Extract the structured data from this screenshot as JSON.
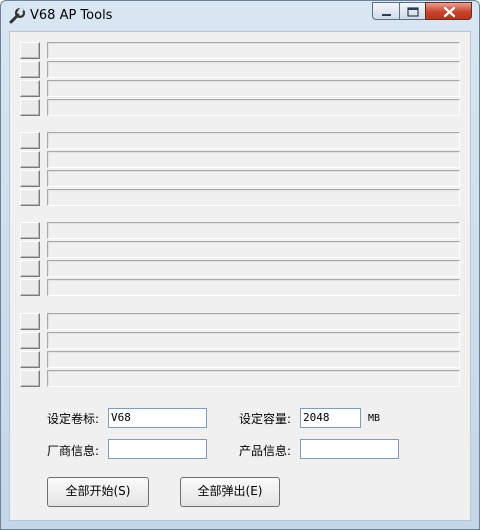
{
  "window": {
    "title": "V68 AP Tools",
    "app_icon": "wrench-icon",
    "controls": [
      "minimize-icon",
      "maximize-icon",
      "close-icon"
    ]
  },
  "port_groups": [
    {
      "rows": [
        {
          "status": ""
        },
        {
          "status": ""
        },
        {
          "status": ""
        },
        {
          "status": ""
        }
      ]
    },
    {
      "rows": [
        {
          "status": ""
        },
        {
          "status": ""
        },
        {
          "status": ""
        },
        {
          "status": ""
        }
      ]
    },
    {
      "rows": [
        {
          "status": ""
        },
        {
          "status": ""
        },
        {
          "status": ""
        },
        {
          "status": ""
        }
      ]
    },
    {
      "rows": [
        {
          "status": ""
        },
        {
          "status": ""
        },
        {
          "status": ""
        },
        {
          "status": ""
        }
      ]
    }
  ],
  "form": {
    "volume_label": "设定卷标:",
    "volume_value": "V68",
    "capacity_label": "设定容量:",
    "capacity_value": "2048",
    "capacity_unit": "MB",
    "vendor_label": "厂商信息:",
    "vendor_value": "",
    "product_label": "产品信息:",
    "product_value": ""
  },
  "buttons": {
    "start_all": "全部开始(S)",
    "eject_all": "全部弹出(E)"
  },
  "colors": {
    "client_bg": "#f0f0f0",
    "title_bar": "#c4d6e8",
    "close_button": "#c8432c",
    "field_border": "#7f9db9"
  }
}
